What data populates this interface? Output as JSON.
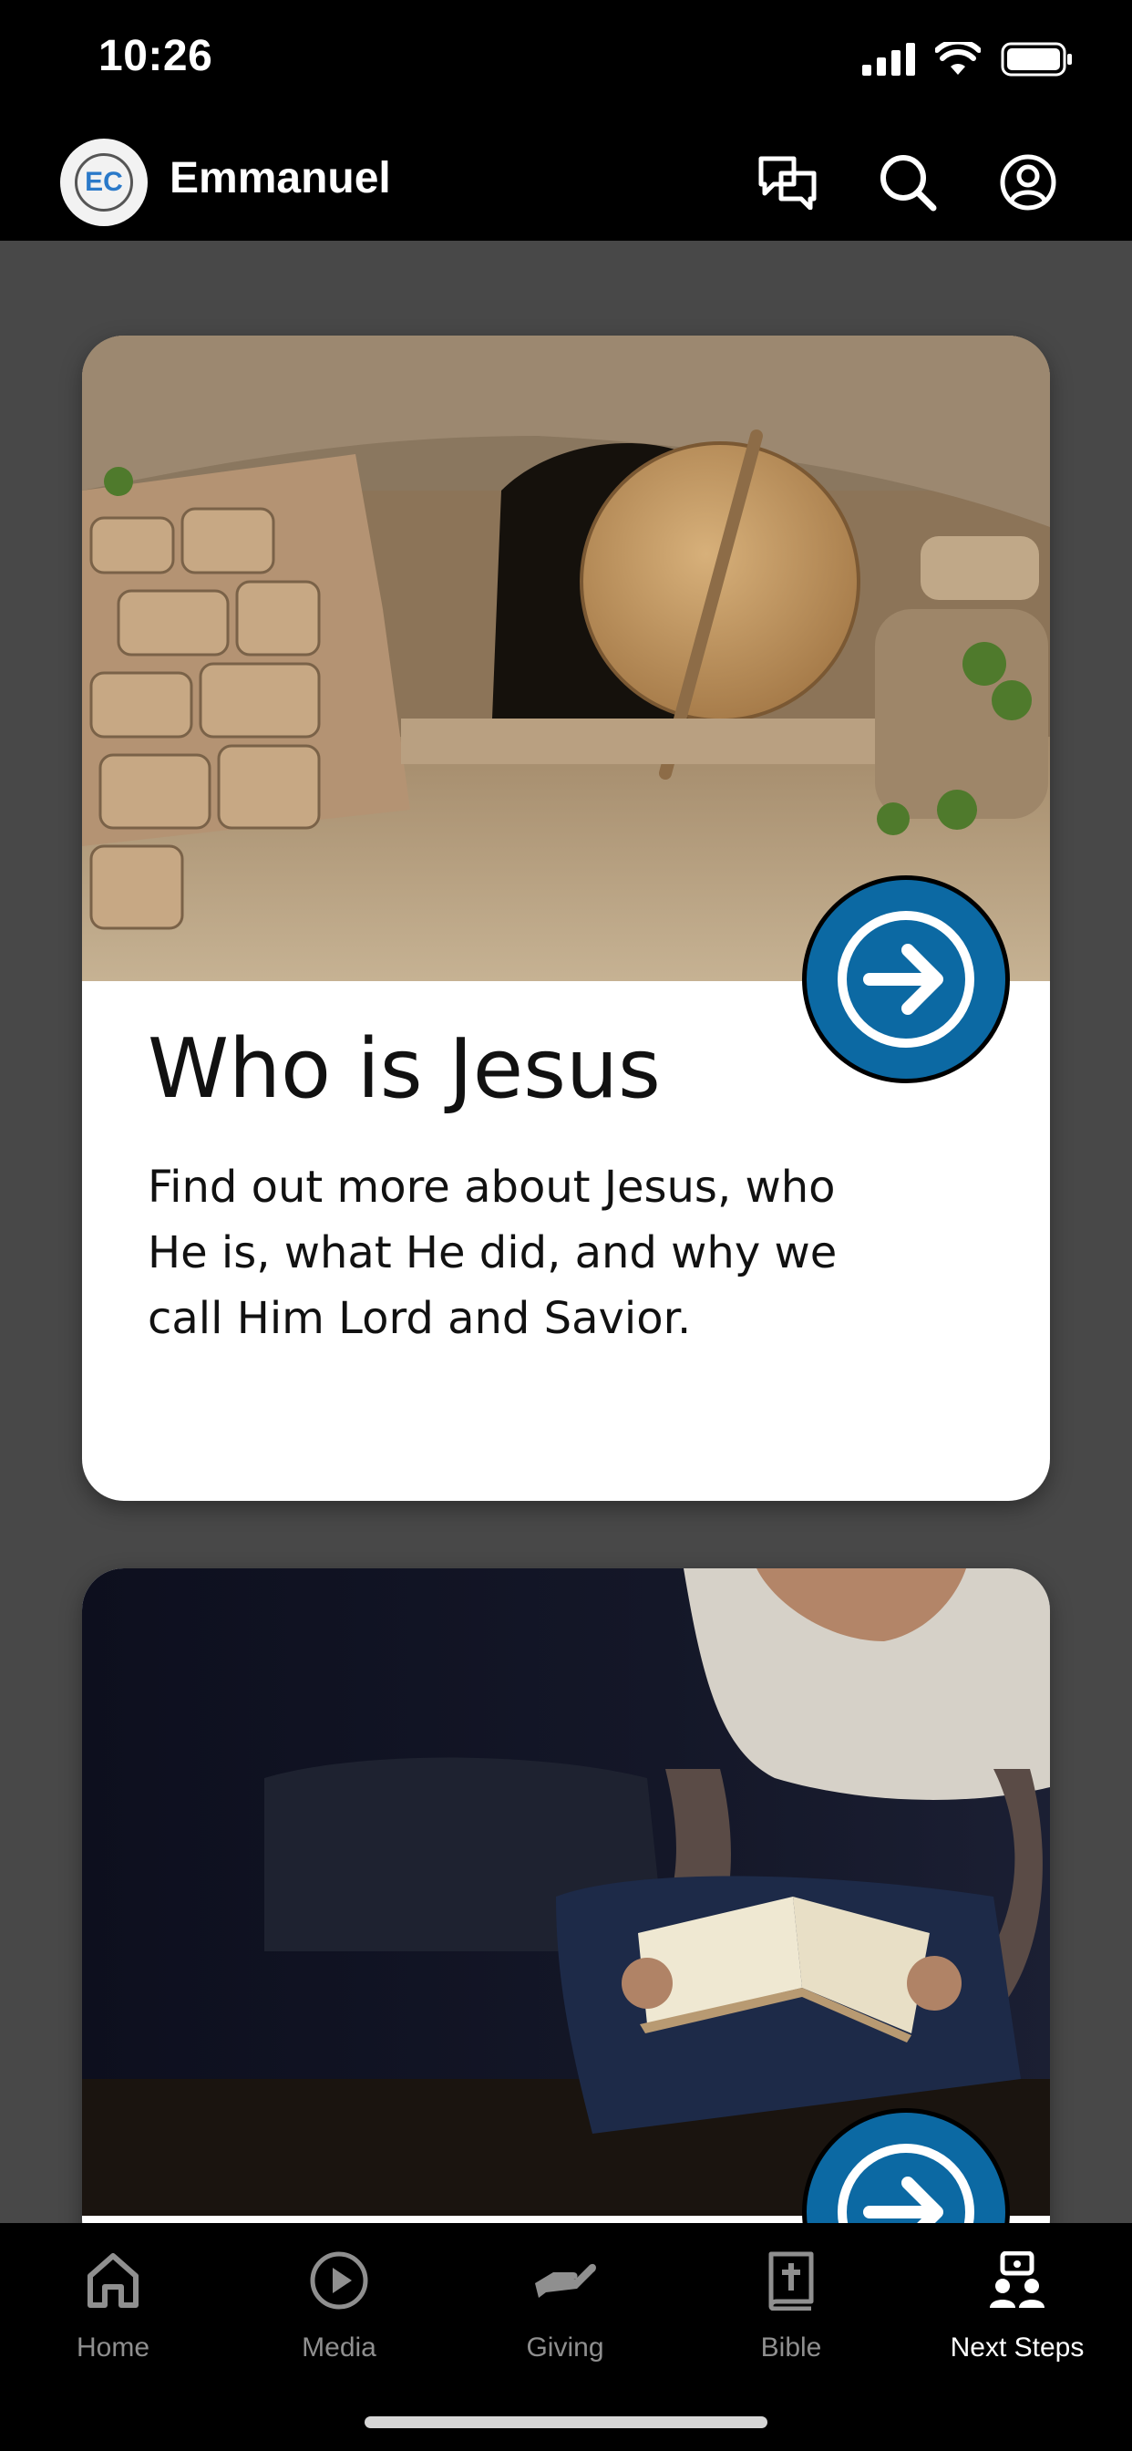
{
  "status_bar": {
    "time": "10:26"
  },
  "header": {
    "avatar_initials": "EC",
    "title": "Emmanuel"
  },
  "cards": [
    {
      "title": "Who is Jesus",
      "description": "Find out more about Jesus, who He is, what He did, and why we call Him Lord and Savior."
    },
    {
      "title": "",
      "description": ""
    }
  ],
  "tab_bar": {
    "items": [
      {
        "label": "Home",
        "icon": "home-icon",
        "active": false
      },
      {
        "label": "Media",
        "icon": "play-icon",
        "active": false
      },
      {
        "label": "Giving",
        "icon": "giving-hand-icon",
        "active": false
      },
      {
        "label": "Bible",
        "icon": "bible-icon",
        "active": false
      },
      {
        "label": "Next Steps",
        "icon": "next-steps-icon",
        "active": true
      }
    ]
  },
  "colors": {
    "background": "#484848",
    "bars": "#000000",
    "accent": "#0c69a3",
    "inactive_tab": "#8f8f8f"
  }
}
